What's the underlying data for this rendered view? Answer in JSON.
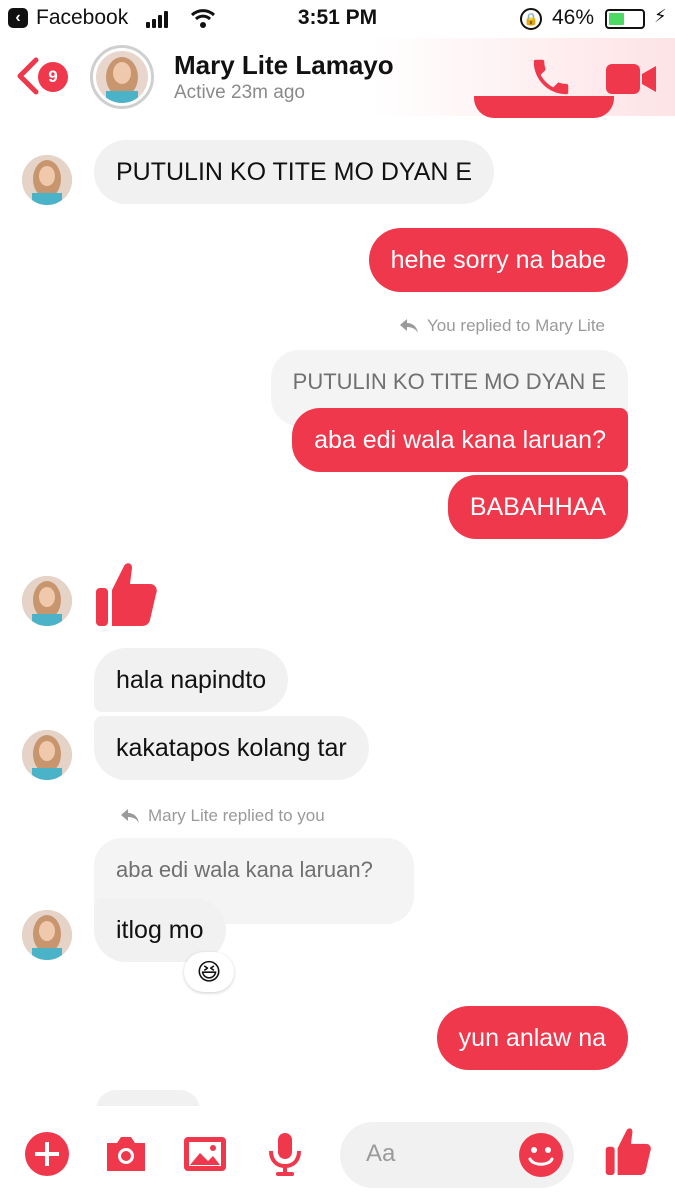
{
  "status_bar": {
    "app": "Facebook",
    "time": "3:51 PM",
    "battery": "46%",
    "battery_level": 0.46
  },
  "header": {
    "back_badge": "9",
    "name": "Mary Lite Lamayo",
    "status": "Active 23m ago",
    "icons": [
      "back-chevron-icon",
      "phone-icon",
      "video-camera-icon"
    ]
  },
  "messages": {
    "m1": "PUTULIN KO TITE MO DYAN E",
    "m2": "hehe sorry na babe",
    "reply1_label": "You replied to Mary Lite",
    "m3_quote": "PUTULIN KO TITE MO DYAN E",
    "m3": "aba edi wala kana laruan?",
    "m4": "BABAHHAA",
    "m5": "hala napindto",
    "m6": "kakatapos kolang tar",
    "reply2_label": "Mary Lite replied to you",
    "m7_quote": "aba edi wala kana laruan?",
    "m7": "itlog mo",
    "m7_reaction": "😆",
    "m8": "yun anlaw na"
  },
  "toolbar": {
    "placeholder": "Aa",
    "icons": [
      "plus-icon",
      "camera-icon",
      "gallery-icon",
      "microphone-icon",
      "emoji-icon",
      "like-icon"
    ]
  },
  "colors": {
    "accent": "#f0384d",
    "incoming_bubble": "#f1f1f1",
    "secondary_text": "#8a8a8a"
  }
}
